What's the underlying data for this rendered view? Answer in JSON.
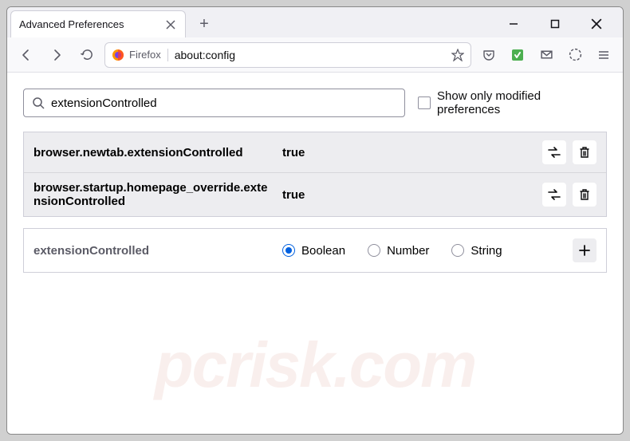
{
  "tab": {
    "title": "Advanced Preferences"
  },
  "urlbar": {
    "identity": "Firefox",
    "url": "about:config"
  },
  "search": {
    "value": "extensionControlled",
    "checkbox_label": "Show only modified preferences"
  },
  "prefs": [
    {
      "name": "browser.newtab.extensionControlled",
      "value": "true"
    },
    {
      "name": "browser.startup.homepage_override.extensionControlled",
      "value": "true"
    }
  ],
  "new_pref": {
    "name": "extensionControlled",
    "types": [
      "Boolean",
      "Number",
      "String"
    ]
  },
  "watermark": "pcrisk.com"
}
